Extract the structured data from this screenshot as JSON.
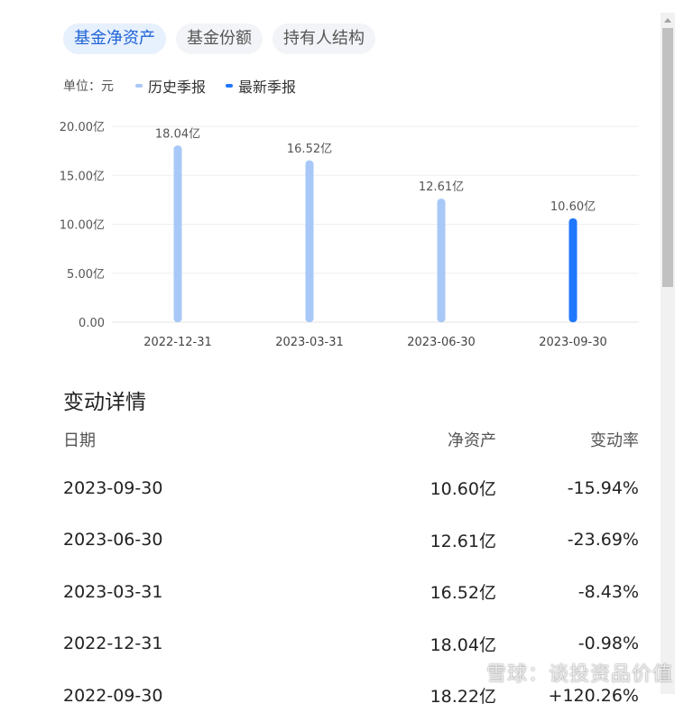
{
  "tabs": [
    {
      "label": "基金净资产",
      "active": true
    },
    {
      "label": "基金份额",
      "active": false
    },
    {
      "label": "持有人结构",
      "active": false
    }
  ],
  "legend": {
    "unit": "单位：元",
    "items": [
      {
        "label": "历史季报",
        "color": "#a8c8f7"
      },
      {
        "label": "最新季报",
        "color": "#1f77ff"
      }
    ]
  },
  "chart_data": {
    "type": "bar",
    "categories": [
      "2022-12-31",
      "2023-03-31",
      "2023-06-30",
      "2023-09-30"
    ],
    "values": [
      18.04,
      16.52,
      12.61,
      10.6
    ],
    "data_labels": [
      "18.04亿",
      "16.52亿",
      "12.61亿",
      "10.60亿"
    ],
    "ylim": [
      0,
      20
    ],
    "yticks": [
      0,
      5,
      10,
      15,
      20
    ],
    "ytick_labels": [
      "0.00",
      "5.00亿",
      "10.00亿",
      "15.00亿",
      "20.00亿"
    ],
    "latest_index": 3,
    "colors": {
      "history": "#a8c8f7",
      "latest": "#1f77ff"
    },
    "grid": true
  },
  "detail": {
    "title": "变动详情",
    "headers": {
      "date": "日期",
      "nav": "净资产",
      "rate": "变动率"
    },
    "rows": [
      {
        "date": "2023-09-30",
        "nav": "10.60亿",
        "rate": "-15.94%"
      },
      {
        "date": "2023-06-30",
        "nav": "12.61亿",
        "rate": "-23.69%"
      },
      {
        "date": "2023-03-31",
        "nav": "16.52亿",
        "rate": "-8.43%"
      },
      {
        "date": "2022-12-31",
        "nav": "18.04亿",
        "rate": "-0.98%"
      },
      {
        "date": "2022-09-30",
        "nav": "18.22亿",
        "rate": "+120.26%"
      }
    ]
  },
  "watermark": "雪球：谈投资品价值"
}
